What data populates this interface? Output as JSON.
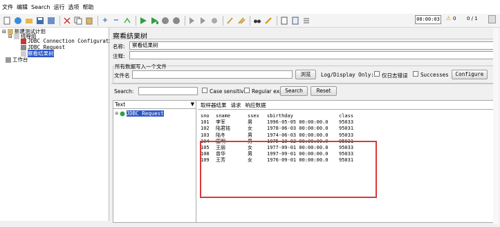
{
  "menu": [
    "文件",
    "编辑",
    "Search",
    "运行",
    "选项",
    "帮助"
  ],
  "toolbar": {
    "timer": "00:00:03",
    "warn_icon": "⚠",
    "warn_count": "0",
    "threads": "0 / 1"
  },
  "tree": {
    "root": "新建测试计划",
    "thread_group": "线程组",
    "items": [
      "JDBC Connection Configurati",
      "JDBC Request",
      "察看结果树"
    ],
    "workbench": "工作台"
  },
  "panel": {
    "title": "察看结果树",
    "name_label": "名称:",
    "name_value": "察看结果树",
    "comment_label": "注释:",
    "comment_value": "",
    "write_all_label": "所有数据写入一个文件",
    "filename_label": "文件名",
    "browse_button": "浏览",
    "log_display_label": "Log/Display Only:",
    "errors_only_label": "仅日志错误",
    "successes_label": "Successes",
    "configure_button": "Configure",
    "search_label": "Search:",
    "search_value": "",
    "case_sensitive_label": "Case sensitive",
    "regex_label": "Regular exp.",
    "search_button": "Search",
    "reset_button": "Reset"
  },
  "results": {
    "renderer": "Text",
    "request_node": "JDBC Request",
    "tabs": [
      "取样器结果",
      "请求",
      "响应数据"
    ],
    "active_tab": 2,
    "header": [
      "sno",
      "sname",
      "ssex",
      "sbirthday",
      "class"
    ],
    "rows": [
      [
        "101",
        "李军",
        "男",
        "1996-05-05 00:00:00.0",
        "95033"
      ],
      [
        "102",
        "陆君铭",
        "女",
        "1978-06-03 00:00:00.0",
        "95031"
      ],
      [
        "103",
        "陆冬",
        "男",
        "1974-06-03 00:00:00.0",
        "95033"
      ],
      [
        "104",
        "匡明",
        "男",
        "1975-10-02 00:00:00.0",
        "95031"
      ],
      [
        "105",
        "王丽",
        "女",
        "1977-09-01 00:00:00.0",
        "95033"
      ],
      [
        "108",
        "曾华",
        "男",
        "1997-09-01 00:00:00.0",
        "95033"
      ],
      [
        "109",
        "王芳",
        "女",
        "1976-09-01 00:00:00.0",
        "95031"
      ]
    ]
  }
}
